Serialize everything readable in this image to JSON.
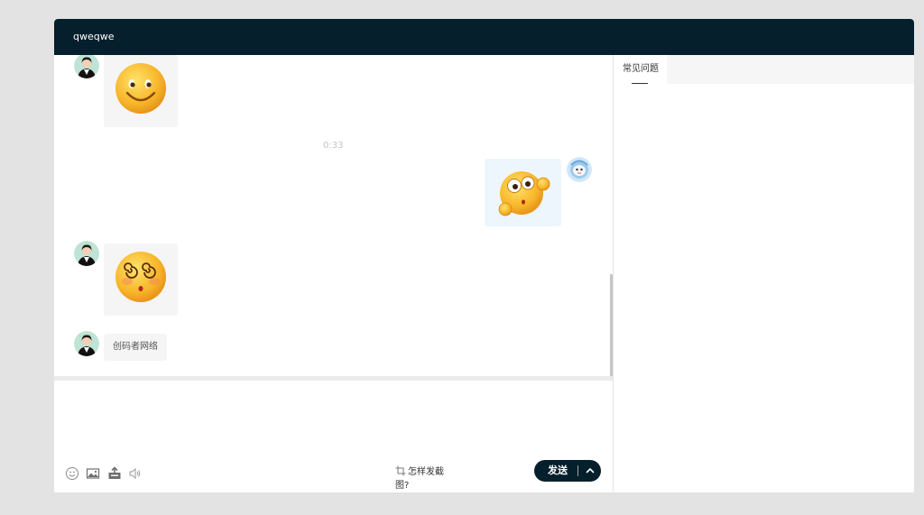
{
  "header": {
    "title": "qweqwe"
  },
  "messages": [
    {
      "side": "left",
      "type": "emoji",
      "emoji": "smile"
    },
    {
      "type": "time",
      "text": "0:33"
    },
    {
      "side": "right",
      "type": "emoji",
      "emoji": "shocked"
    },
    {
      "side": "left",
      "type": "emoji",
      "emoji": "dizzy"
    },
    {
      "side": "left",
      "type": "text",
      "text": "创码者网络"
    }
  ],
  "toolbar": {
    "icons": [
      "emoji-icon",
      "image-icon",
      "file-upload-icon",
      "voice-icon"
    ],
    "crop_tip": "怎样发截图?",
    "send_label": "发送"
  },
  "side_panel": {
    "tabs": [
      {
        "label": "常见问题",
        "active": true
      }
    ]
  },
  "colors": {
    "header_bg": "#061f2c",
    "send_bg": "#061f2c",
    "page_bg": "#e3e3e3",
    "bubble_left": "#f5f5f5",
    "bubble_right": "#eef6fd"
  }
}
